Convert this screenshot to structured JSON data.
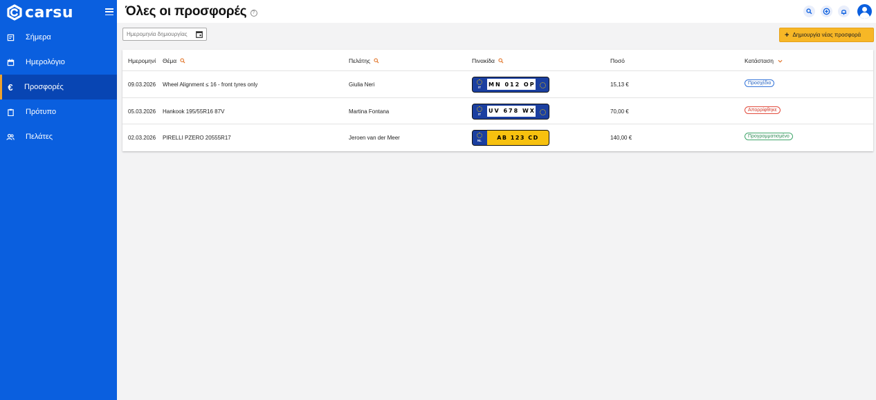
{
  "brand": {
    "name": "carsu"
  },
  "sidebar": {
    "items": [
      {
        "label": "Σήμερα",
        "icon": "today-icon"
      },
      {
        "label": "Ημερολόγιο",
        "icon": "calendar-icon"
      },
      {
        "label": "Προσφορές",
        "icon": "euro-icon",
        "active": true,
        "icon_glyph": "€"
      },
      {
        "label": "Πρότυπο",
        "icon": "clipboard-icon"
      },
      {
        "label": "Πελάτες",
        "icon": "customers-icon"
      }
    ]
  },
  "header": {
    "title": "Όλες οι προσφορές"
  },
  "filters": {
    "date_placeholder": "Ημερομηνία δημιουργίας"
  },
  "actions": {
    "create_label": "Δημιουργία νέας προσφορά",
    "create_plus": "+"
  },
  "table": {
    "columns": [
      "Ημερομηνί",
      "Θέμα",
      "Πελάτης",
      "Πινακίδα",
      "Ποσό",
      "Κατάσταση"
    ],
    "rows": [
      {
        "date": "09.03.2026",
        "subject": "Wheel Alignment ≤ 16 - front tyres only",
        "customer": "Giulia Neri",
        "plate": "MN 012 OP",
        "plate_country": "IT",
        "amount": "15,13 €",
        "status": "Προσχέδιο",
        "status_type": "draft"
      },
      {
        "date": "05.03.2026",
        "subject": "Hankook 195/55R16 87V",
        "customer": "Martina Fontana",
        "plate": "UV 678 WX",
        "plate_country": "IT",
        "amount": "70,00 €",
        "status": "Απορρίφθηκε",
        "status_type": "rejected"
      },
      {
        "date": "02.03.2026",
        "subject": "PIRELLI PZERO 20555R17",
        "customer": "Jeroen van der Meer",
        "plate": "AB 123 CD",
        "plate_country": "NL",
        "amount": "140,00 €",
        "status": "Προγραμματισμένο",
        "status_type": "planned"
      }
    ]
  },
  "colors": {
    "primary": "#0a5fdf",
    "accent": "#f7b726",
    "active_border": "#f0a22c"
  }
}
